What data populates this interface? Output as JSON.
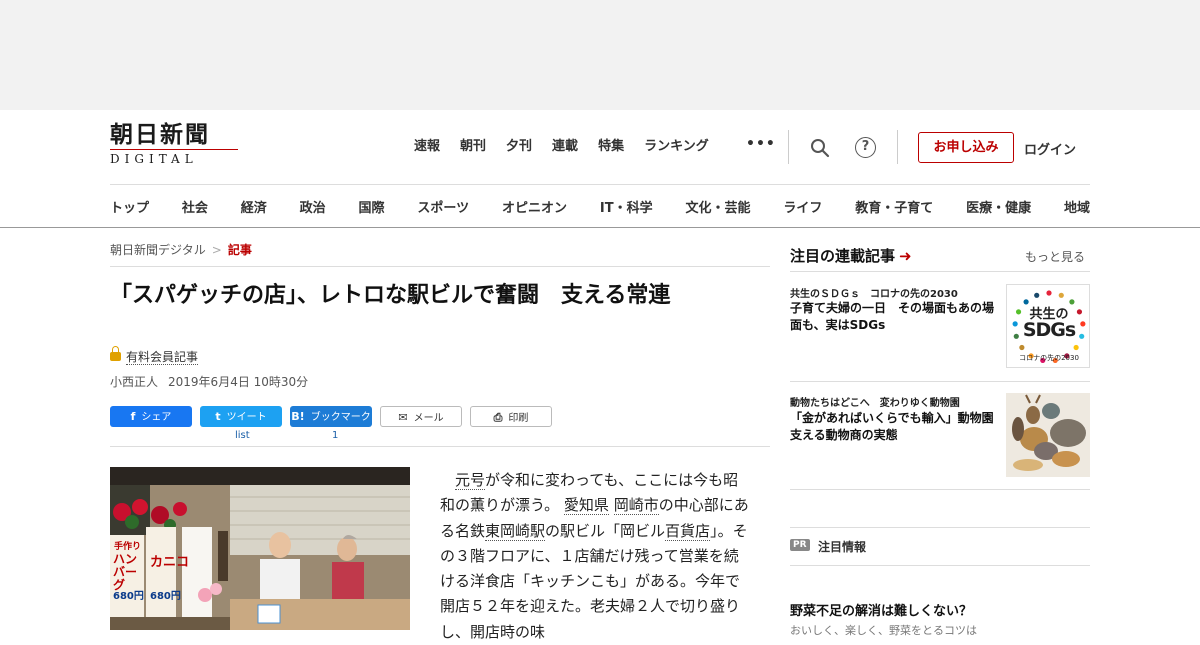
{
  "logo": {
    "main": "朝日新聞",
    "sub": "DIGITAL"
  },
  "topnav": [
    "速報",
    "朝刊",
    "夕刊",
    "連載",
    "特集",
    "ランキング"
  ],
  "header": {
    "more": "•••",
    "apply": "お申し込み",
    "help": "?",
    "login": "ログイン"
  },
  "catnav": [
    "トップ",
    "社会",
    "経済",
    "政治",
    "国際",
    "スポーツ",
    "オピニオン",
    "IT・科学",
    "文化・芸能",
    "ライフ",
    "教育・子育て",
    "医療・健康",
    "地域"
  ],
  "breadcrumb": {
    "home": "朝日新聞デジタル",
    "sep": ">",
    "current": "記事"
  },
  "article": {
    "title": "「スパゲッチの店」、レトロな駅ビルで奮闘　支える常連",
    "paid_label": "有料会員記事",
    "author": "小西正人",
    "date": "2019年6月4日 10時30分",
    "body": [
      {
        "t": "　元号",
        "link": false
      },
      {
        "t": "元号",
        "link": true
      },
      {
        "t": "が令和に変わっても、ここには今も昭和の薫りが漂う。",
        "link": false
      },
      {
        "t": "愛知県",
        "link": true
      },
      {
        "t": " ",
        "link": false
      },
      {
        "t": "岡崎市",
        "link": true
      },
      {
        "t": "の中心部にある名鉄",
        "link": false
      },
      {
        "t": "東岡崎駅",
        "link": true
      },
      {
        "t": "の駅ビル「岡ビル",
        "link": false
      },
      {
        "t": "百貨店",
        "link": true
      },
      {
        "t": "」。その３階フロアに、１店舗だけ残って営業を続ける洋食店「キッチンこも」がある。今年で開店５２年を迎えた。老夫婦２人で切り盛りし、開店時の味",
        "link": false
      }
    ]
  },
  "share": {
    "facebook": "シェア",
    "facebook_icon": "f",
    "twitter": "ツイート",
    "twitter_icon": "t",
    "hatena": "ブックマーク",
    "hatena_icon": "B!",
    "mail": "メール",
    "mail_icon": "✉",
    "print": "印刷",
    "print_icon": "⎙",
    "twitter_count": "list",
    "hatena_count": "1"
  },
  "photo": {
    "sign_left": "ハンバーグ",
    "sign_left_top": "手作り",
    "price1": "680円",
    "sign_mid": "カニコ",
    "price2": "680円"
  },
  "sidebar": {
    "heading": "注目の連載記事",
    "more": "もっと見る",
    "cards": [
      {
        "kicker": "共生のＳＤＧｓ　コロナの先の2030",
        "title": "子育て夫婦の一日　その場面もあの場面も、実はSDGs",
        "thumb_title": "共生の",
        "thumb_big": "SDGs",
        "thumb_sub": "コロナの先の2030"
      },
      {
        "kicker": "動物たちはどこへ　変わりゆく動物園",
        "title": "「金があればいくらでも輸入」動物園支える動物商の実態"
      }
    ],
    "pr_badge": "PR",
    "pr_label": "注目情報",
    "pr_title": "野菜不足の解消は難しくない？",
    "pr_sub": "おいしく、楽しく、野菜をとるコツは"
  },
  "colors": {
    "brand_red": "#b00000",
    "facebook": "#1877f2",
    "twitter": "#1da1f2",
    "hatena": "#1d7cd6",
    "ad_band": "#f2f2f2"
  }
}
